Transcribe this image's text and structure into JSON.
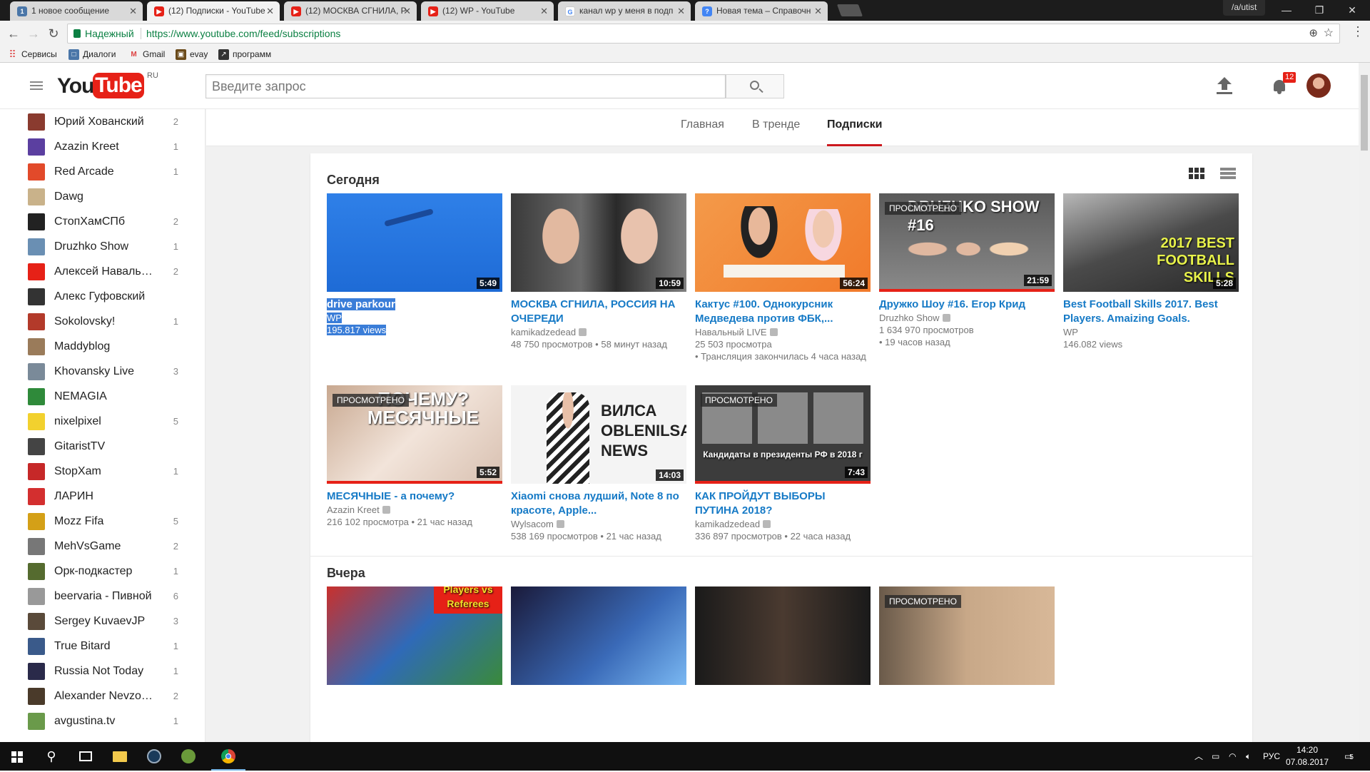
{
  "browser": {
    "tabs": [
      {
        "label": "1 новое сообщение",
        "icon": "vk-icon"
      },
      {
        "label": "(12) Подписки - YouTube",
        "icon": "youtube-icon"
      },
      {
        "label": "(12) МОСКВА СГНИЛА, Р",
        "icon": "youtube-icon"
      },
      {
        "label": "(12) WP - YouTube",
        "icon": "youtube-icon"
      },
      {
        "label": "канал wp у меня в подп",
        "icon": "google-icon"
      },
      {
        "label": "Новая тема – Справочн",
        "icon": "docs-icon"
      }
    ],
    "profile_name": "/a/utist",
    "secure_label": "Надежный",
    "url": "https://www.youtube.com/feed/subscriptions",
    "bookmarks": [
      "Сервисы",
      "Диалоги",
      "Gmail",
      "evay",
      "программ"
    ]
  },
  "youtube": {
    "logo_you": "You",
    "logo_tube": "Tube",
    "logo_region": "RU",
    "search_placeholder": "Введите запрос",
    "notification_count": "12",
    "feed_tabs": [
      "Главная",
      "В тренде",
      "Подписки"
    ],
    "active_tab": "Подписки"
  },
  "subscriptions": [
    {
      "name": "Юрий Хованский",
      "count": "2",
      "color": "#8a3b2f"
    },
    {
      "name": "Azazin Kreet",
      "count": "1",
      "color": "#5b3fa0"
    },
    {
      "name": "Red Arcade",
      "count": "1",
      "color": "#e24a2a"
    },
    {
      "name": "Dawg",
      "count": "",
      "color": "#c9b28a"
    },
    {
      "name": "СтопХамСПб",
      "count": "2",
      "color": "#222222"
    },
    {
      "name": "Druzhko Show",
      "count": "1",
      "color": "#6a8fb3"
    },
    {
      "name": "Алексей Навальный",
      "count": "2",
      "color": "#e62117"
    },
    {
      "name": "Алекс Гуфовский",
      "count": "",
      "color": "#333333"
    },
    {
      "name": "Sokolovsky!",
      "count": "1",
      "color": "#b33a2a"
    },
    {
      "name": "Maddyblog",
      "count": "",
      "color": "#9a7b5a"
    },
    {
      "name": "Khovansky Live",
      "count": "3",
      "color": "#7a8a99"
    },
    {
      "name": "NEMAGIA",
      "count": "",
      "color": "#2f8a3a"
    },
    {
      "name": "nixelpixel",
      "count": "5",
      "color": "#f2d12e"
    },
    {
      "name": "GitaristTV",
      "count": "",
      "color": "#444444"
    },
    {
      "name": "StopXam",
      "count": "1",
      "color": "#c62828"
    },
    {
      "name": "ЛАРИН",
      "count": "",
      "color": "#d32f2f"
    },
    {
      "name": "Mozz Fifa",
      "count": "5",
      "color": "#d4a017"
    },
    {
      "name": "MehVsGame",
      "count": "2",
      "color": "#777777"
    },
    {
      "name": "Орк-подкастер",
      "count": "1",
      "color": "#556b2f"
    },
    {
      "name": "beervaria - Пивной",
      "count": "6",
      "color": "#999999"
    },
    {
      "name": "Sergey KuvaevJP",
      "count": "3",
      "color": "#5a4a3a"
    },
    {
      "name": "True Bitard",
      "count": "1",
      "color": "#3a5a8a"
    },
    {
      "name": "Russia Not Today",
      "count": "1",
      "color": "#2a2a4a"
    },
    {
      "name": "Alexander Nevzorov",
      "count": "2",
      "color": "#4a3a2a"
    },
    {
      "name": "avgustina.tv",
      "count": "1",
      "color": "#6a9a4a"
    }
  ],
  "shelves": {
    "today_title": "Сегодня",
    "yesterday_title": "Вчера"
  },
  "today_videos": [
    {
      "title": "drive parkour",
      "channel": "WP",
      "meta": "195.817 views",
      "duration": "5:49",
      "watched": ""
    },
    {
      "title": "МОСКВА СГНИЛА, РОССИЯ НА ОЧЕРЕДИ",
      "channel": "kamikadzedead",
      "meta": "48 750 просмотров • 58 минут назад",
      "duration": "10:59",
      "watched": ""
    },
    {
      "title": "Кактус #100. Однокурсник Медведева против ФБК,...",
      "channel": "Навальный LIVE",
      "meta": "25 503 просмотра",
      "meta2": "• Трансляция закончилась 4 часа назад",
      "duration": "56:24",
      "watched": ""
    },
    {
      "title": "Дружко Шоу #16. Егор Крид",
      "channel": "Druzhko Show",
      "meta": "1 634 970 просмотров",
      "meta2": "• 19 часов назад",
      "duration": "21:59",
      "watched": "ПРОСМОТРЕНО",
      "thumb_text": "DRUZHKO SHOW #16"
    },
    {
      "title": "Best Football Skills 2017. Best Players. Amaizing Goals.",
      "channel": "WP",
      "meta": "146.082 views",
      "duration": "5:28",
      "watched": "",
      "thumb_text": "2017 BEST FOOTBALL SKILLS"
    },
    {
      "title": "МЕСЯЧНЫЕ - а почему?",
      "channel": "Azazin Kreet",
      "meta": "216 102 просмотра • 21 час назад",
      "duration": "5:52",
      "watched": "ПРОСМОТРЕНО",
      "thumb_text": "ПОЧЕМУ? МЕСЯЧНЫЕ"
    },
    {
      "title": "Xiaomi снова лудший, Note 8 по красоте, Apple...",
      "channel": "Wylsacom",
      "meta": "538 169 просмотров • 21 час назад",
      "duration": "14:03",
      "watched": "",
      "thumb_text": "ВИЛСА OBLENILSA NEWS"
    },
    {
      "title": "КАК ПРОЙДУТ ВЫБОРЫ ПУТИНА 2018?",
      "channel": "kamikadzedead",
      "meta": "336 897 просмотров • 22 часа назад",
      "duration": "7:43",
      "watched": "ПРОСМОТРЕНО",
      "thumb_text": "Кандидаты в президенты РФ в 2018 г"
    }
  ],
  "yesterday_videos": [
    {
      "watched": "",
      "thumb_text": "Players vs Referees"
    },
    {
      "watched": "",
      "thumb_text": ""
    },
    {
      "watched": "",
      "thumb_text": ""
    },
    {
      "watched": "ПРОСМОТРЕНО",
      "thumb_text": ""
    }
  ],
  "taskbar": {
    "language": "РУС",
    "time": "14:20",
    "date": "07.08.2017",
    "notifications": "5"
  }
}
